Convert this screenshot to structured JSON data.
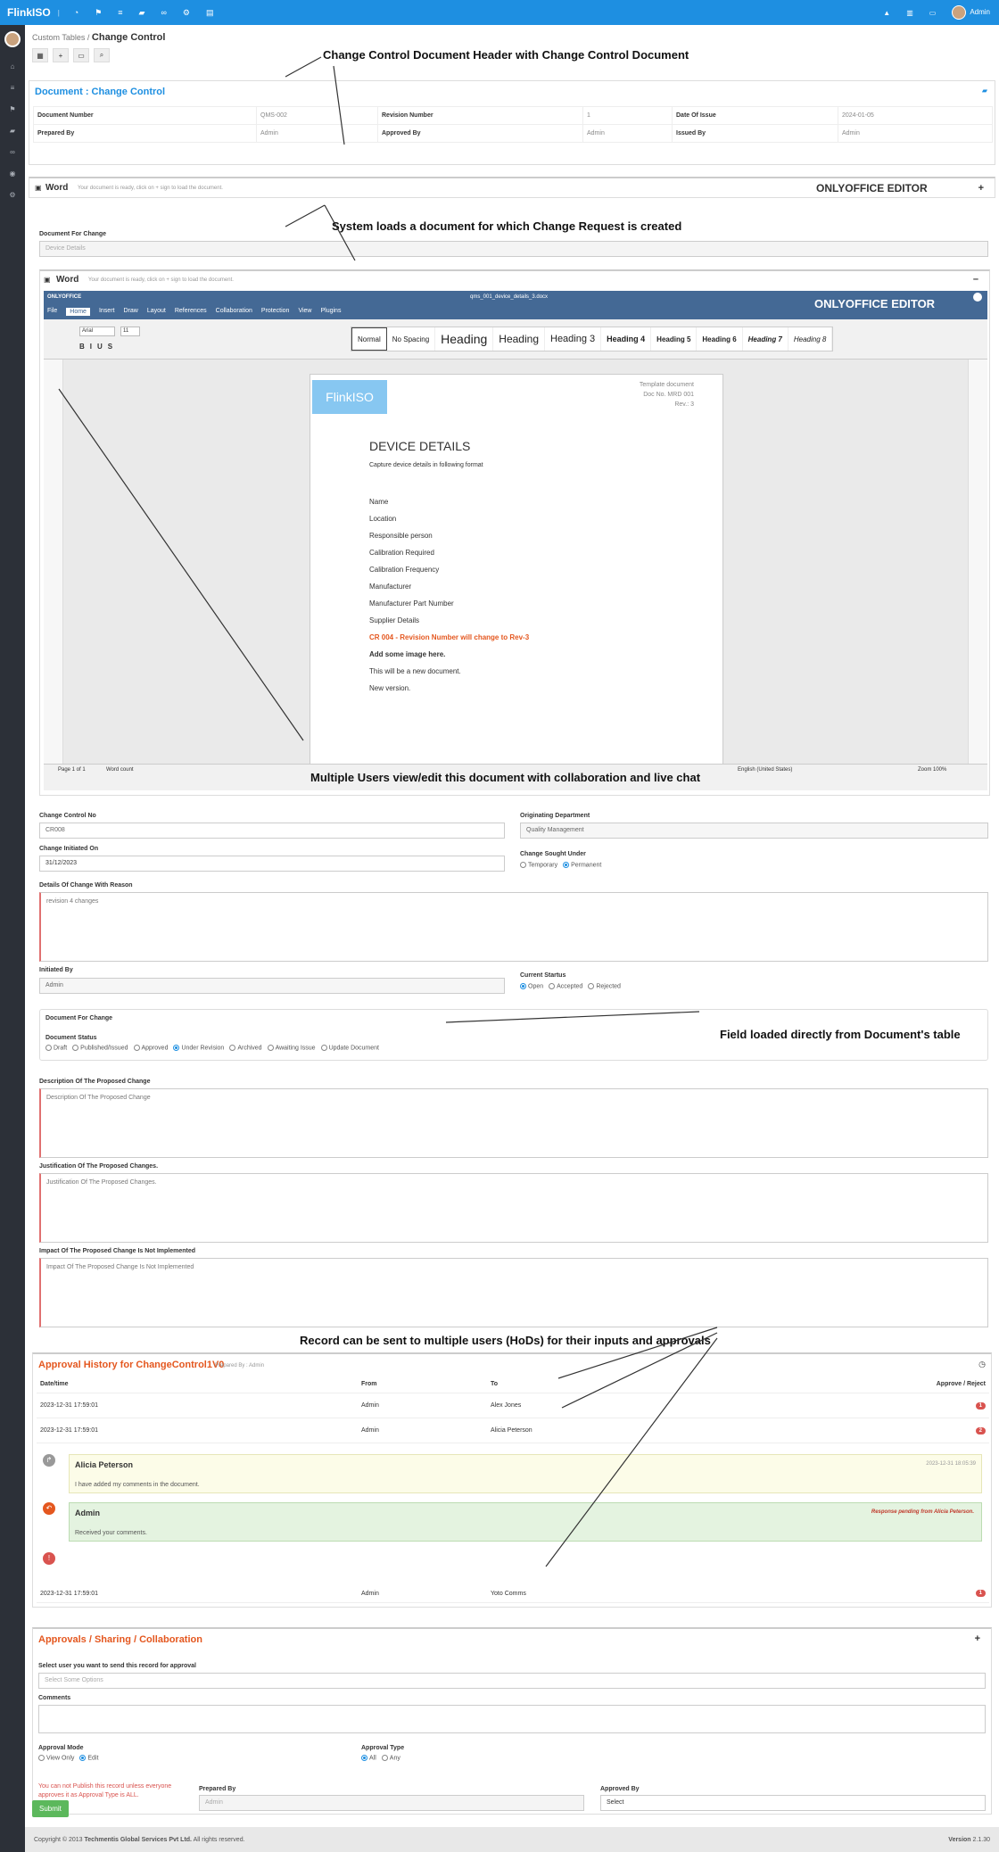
{
  "topbar": {
    "brand": "FlinkISO",
    "user": "Admin"
  },
  "breadcrumb": {
    "parent": "Custom Tables",
    "sep": "/",
    "current": "Change Control"
  },
  "callouts": {
    "c1": "Change Control Document Header with Change Control Document",
    "c2": "System loads a document for which Change Request is created",
    "c3": "Multiple Users view/edit this document with collaboration and live chat",
    "c4": "Field loaded directly from Document's table",
    "c5": "Record can be sent to multiple users (HoDs) for their inputs and approvals",
    "oo1": "ONLYOFFICE EDITOR",
    "oo2": "ONLYOFFICE EDITOR"
  },
  "doc_header": {
    "title": "Document : Change Control",
    "rows": [
      [
        "Document Number",
        "QMS-002",
        "Revision Number",
        "1",
        "Date Of Issue",
        "2024-01-05"
      ],
      [
        "Prepared By",
        "Admin",
        "Approved By",
        "Admin",
        "Issued By",
        "Admin"
      ]
    ]
  },
  "word1": {
    "title": "Word",
    "msg": "Your document is ready, click on + sign to load the document.",
    "btn": "+"
  },
  "doc_for_change": {
    "label": "Document For Change",
    "value": "Device Details"
  },
  "word2": {
    "title": "Word",
    "msg": "Your document is ready, click on + sign to load the document.",
    "btn": "–"
  },
  "editor": {
    "app": "ONLYOFFICE",
    "filename": "qms_001_device_details_3.docx",
    "tabs": [
      "File",
      "Home",
      "Insert",
      "Draw",
      "Layout",
      "References",
      "Collaboration",
      "Protection",
      "View",
      "Plugins"
    ],
    "styles": [
      "Normal",
      "No Spacing",
      "Heading",
      "Heading",
      "Heading 3",
      "Heading 4",
      "Heading 5",
      "Heading 6",
      "Heading 7",
      "Heading 8"
    ],
    "font": "Arial",
    "size": "11",
    "status_left": "Page 1 of 1",
    "word_count": "Word count",
    "lang": "English (United States)",
    "zoom": "Zoom 100%"
  },
  "docpage": {
    "logo": "FlinkISO",
    "tpl1": "Template document",
    "tpl2": "Doc No. MRD 001",
    "tpl3": "Rev.: 3",
    "heading": "DEVICE DETAILS",
    "sub": "Capture device details in following format",
    "fields": [
      "Name",
      "Location",
      "Responsible person",
      "Calibration Required",
      "Calibration Frequency",
      "Manufacturer",
      "Manufacturer Part Number",
      "Supplier Details"
    ],
    "cr": "CR 004 - Revision Number will change to Rev-3",
    "img": "Add some image here.",
    "new1": "This will be a new document.",
    "new2": "New version."
  },
  "form": {
    "ccno_label": "Change Control No",
    "ccno": "CR008",
    "dept_label": "Originating Department",
    "dept": "Quality Management",
    "init_label": "Change Initiated On",
    "init": "31/12/2023",
    "sought_label": "Change Sought Under",
    "sought": [
      "Temporary",
      "Permanent"
    ],
    "details_label": "Details Of Change With Reason",
    "details": "revision 4 changes",
    "by_label": "Initiated By",
    "by": "Admin",
    "status_label": "Current Startus",
    "status": [
      "Open",
      "Accepted",
      "Rejected"
    ],
    "dfc": "Document For Change",
    "ds_label": "Document Status",
    "ds": [
      "Draft",
      "Published/Issued",
      "Approved",
      "Under Revision",
      "Archived",
      "Awaiting Issue",
      "Update Document"
    ],
    "desc_label": "Description Of The Proposed Change",
    "desc_ph": "Description Of The Proposed Change",
    "just_label": "Justification Of The Proposed Changes.",
    "just_ph": "Justification Of The Proposed Changes.",
    "imp_label": "Impact Of The Proposed Change Is Not Implemented",
    "imp_ph": "Impact Of The Proposed Change Is Not Implemented"
  },
  "approval_history": {
    "title": "Approval History for ChangeControl1V0",
    "sub": "Prepared By : Admin",
    "cols": [
      "Date/time",
      "From",
      "To",
      "Approve / Reject"
    ],
    "rows": [
      [
        "2023-12-31 17:59:01",
        "Admin",
        "Alex Jones",
        "1"
      ],
      [
        "2023-12-31 17:59:01",
        "Admin",
        "Alicia Peterson",
        "2"
      ]
    ],
    "c1_name": "Alicia Peterson",
    "c1_time": "2023-12-31 18:05:39",
    "c1_text": "I have added my comments in the document.",
    "c2_name": "Admin",
    "c2_pending": "Response pending from Alicia Peterson.",
    "c2_text": "Received your comments.",
    "last": [
      "2023-12-31 17:59:01",
      "Admin",
      "Yoto Comms",
      "1"
    ]
  },
  "approvals": {
    "title": "Approvals / Sharing / Collaboration",
    "btn": "+",
    "select_label": "Select user you want to send this record for approval",
    "select_ph": "Select Some Options",
    "comments_label": "Comments",
    "mode_label": "Approval Mode",
    "mode": [
      "View Only",
      "Edit"
    ],
    "type_label": "Approval Type",
    "type": [
      "All",
      "Any"
    ],
    "warn": "You can not Publish this record unless everyone approves it as Approval Type is ALL.",
    "prep_label": "Prepared By",
    "prep": "Admin",
    "appr_label": "Approved By",
    "appr": "Select"
  },
  "submit": "Submit",
  "footer": {
    "copy": "Copyright © 2013",
    "company": "Techmentis Global Services Pvt Ltd.",
    "rights": "All rights reserved.",
    "version": "Version",
    "ver": "2.1.30"
  }
}
